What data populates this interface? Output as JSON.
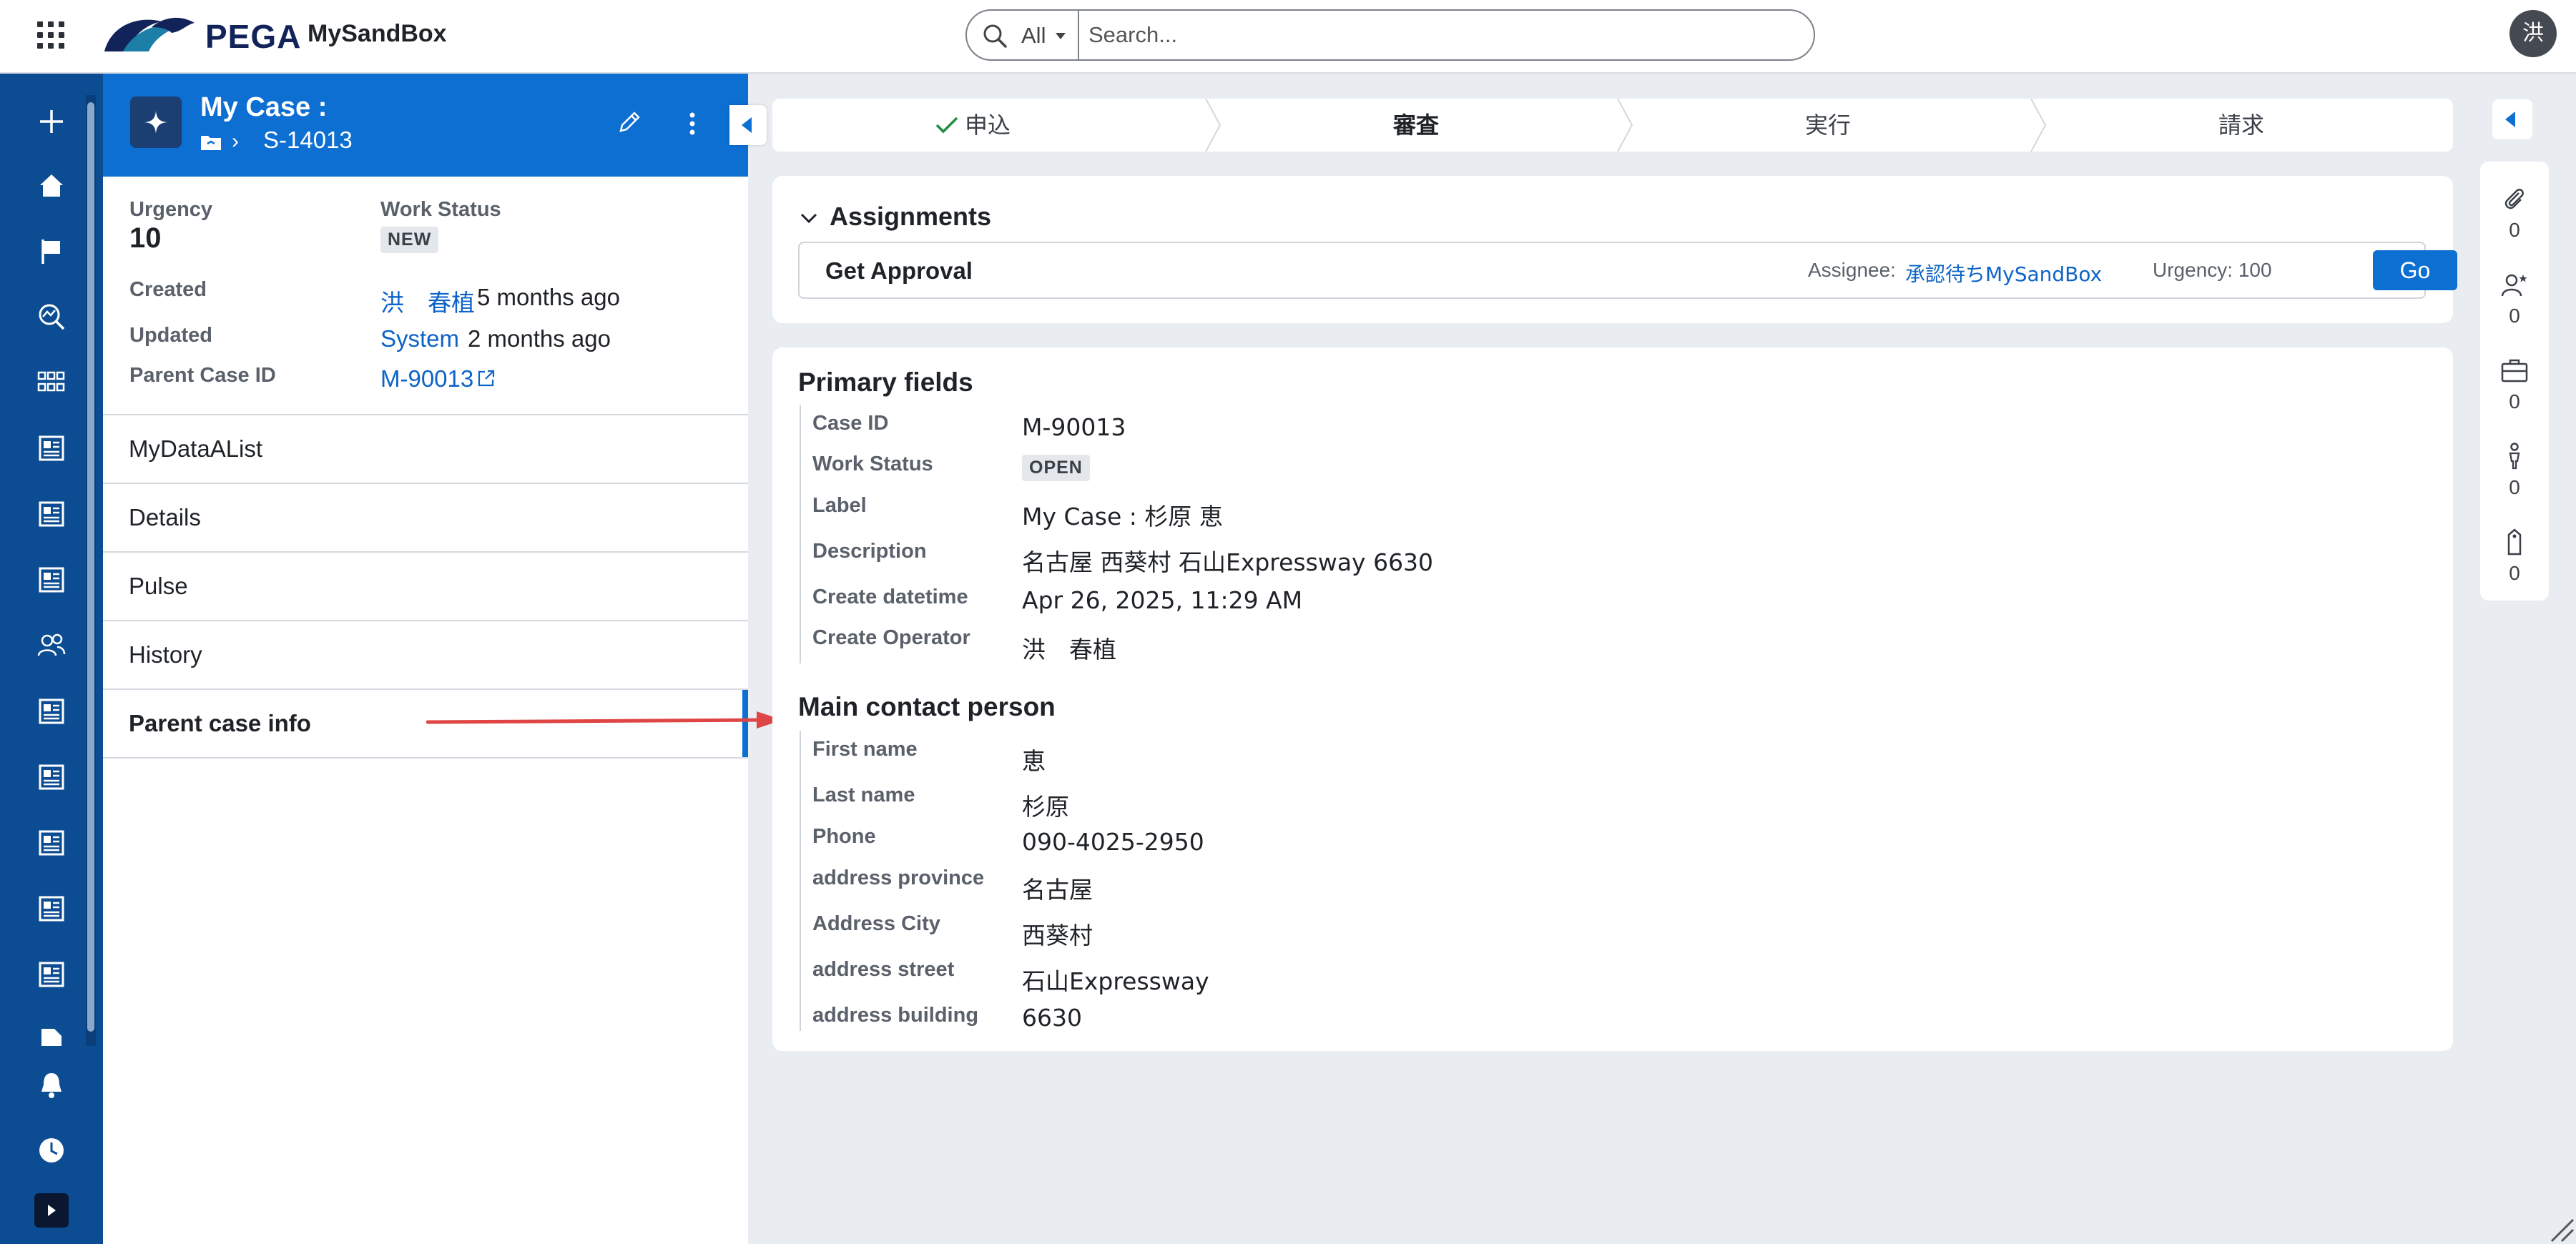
{
  "app": {
    "brand": "PEGA",
    "app_name": "MySandBox",
    "avatar_initial": "洪",
    "accent_color": "#0d6fd1",
    "nav_color": "#0c4c93"
  },
  "search": {
    "scope": "All",
    "placeholder": "Search..."
  },
  "case": {
    "title": "My Case :",
    "id": "S-14013",
    "summary": {
      "urgency_label": "Urgency",
      "urgency_value": "10",
      "work_status_label": "Work Status",
      "work_status_value": "NEW",
      "created_label": "Created",
      "created_by": "洪　春植",
      "created_when": "5 months ago",
      "updated_label": "Updated",
      "updated_by": "System",
      "updated_when": "2 months ago",
      "parent_label": "Parent Case ID",
      "parent_value": "M-90013"
    },
    "tabs": [
      "MyDataAList",
      "Details",
      "Pulse",
      "History",
      "Parent case info"
    ],
    "active_tab": "Parent case info"
  },
  "stages": [
    {
      "label": "申込",
      "status": "completed"
    },
    {
      "label": "審査",
      "status": "current"
    },
    {
      "label": "実行",
      "status": "pending"
    },
    {
      "label": "請求",
      "status": "pending"
    }
  ],
  "assignments": {
    "heading": "Assignments",
    "items": [
      {
        "name": "Get Approval",
        "assignee_label": "Assignee:",
        "assignee": "承認待ちMySandBox",
        "urgency": "Urgency: 100",
        "go_label": "Go"
      }
    ]
  },
  "primary_fields": {
    "heading": "Primary fields",
    "fields": [
      {
        "label": "Case ID",
        "value": "M-90013"
      },
      {
        "label": "Work Status",
        "value": "OPEN"
      },
      {
        "label": "Label",
        "value": "My Case : 杉原 恵"
      },
      {
        "label": "Description",
        "value": "名古屋 西葵村 石山Expressway 6630"
      },
      {
        "label": "Create datetime",
        "value": "Apr 26, 2025, 11:29 AM"
      },
      {
        "label": "Create Operator",
        "value": "洪　春植"
      }
    ]
  },
  "main_contact": {
    "heading": "Main contact person",
    "fields": [
      {
        "label": "First name",
        "value": "恵"
      },
      {
        "label": "Last name",
        "value": "杉原"
      },
      {
        "label": "Phone",
        "value": "090-4025-2950"
      },
      {
        "label": "address province",
        "value": "名古屋"
      },
      {
        "label": "Address City",
        "value": "西葵村"
      },
      {
        "label": "address street",
        "value": "石山Expressway"
      },
      {
        "label": "address building",
        "value": "6630"
      }
    ]
  },
  "utility": {
    "items": [
      {
        "icon": "paperclip-icon",
        "count": "0"
      },
      {
        "icon": "followers-icon",
        "count": "0"
      },
      {
        "icon": "briefcase-icon",
        "count": "0"
      },
      {
        "icon": "stakeholder-icon",
        "count": "0"
      },
      {
        "icon": "tag-icon",
        "count": "0"
      }
    ]
  }
}
